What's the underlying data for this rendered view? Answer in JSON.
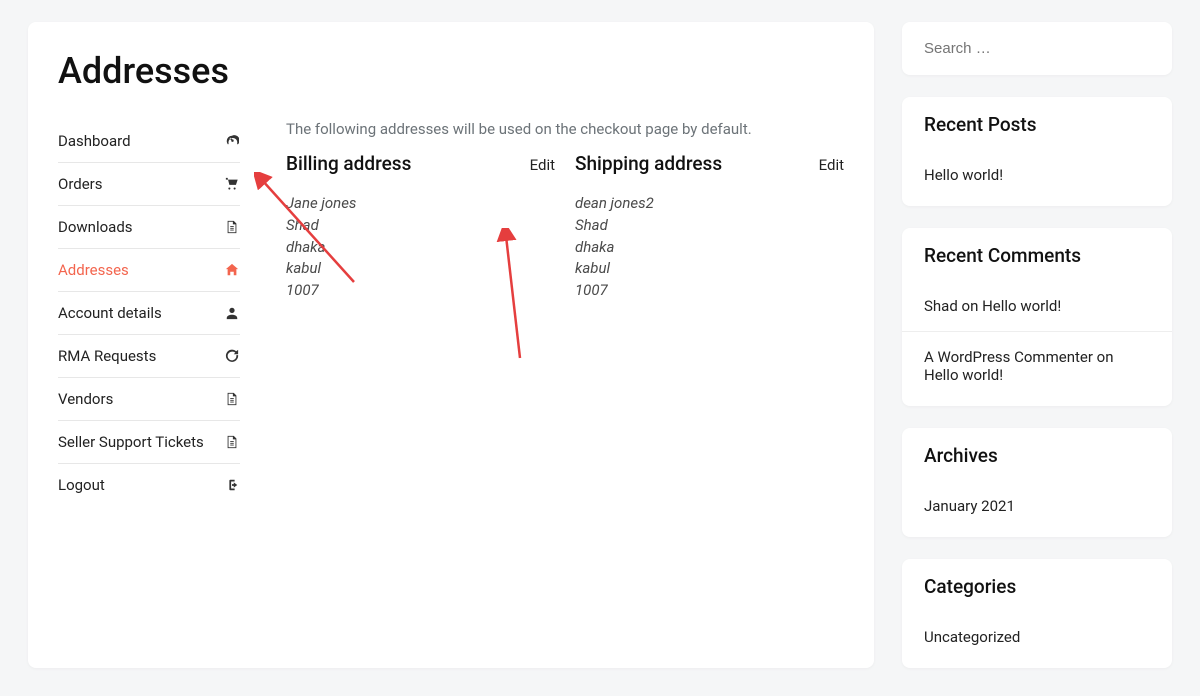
{
  "page": {
    "title": "Addresses",
    "intro": "The following addresses will be used on the checkout page by default."
  },
  "nav": [
    {
      "label": "Dashboard",
      "icon": "dashboard-icon",
      "active": false
    },
    {
      "label": "Orders",
      "icon": "cart-icon",
      "active": false
    },
    {
      "label": "Downloads",
      "icon": "file-icon",
      "active": false
    },
    {
      "label": "Addresses",
      "icon": "home-icon",
      "active": true
    },
    {
      "label": "Account details",
      "icon": "user-icon",
      "active": false
    },
    {
      "label": "RMA Requests",
      "icon": "refresh-icon",
      "active": false
    },
    {
      "label": "Vendors",
      "icon": "file-icon",
      "active": false
    },
    {
      "label": "Seller Support Tickets",
      "icon": "file-icon",
      "active": false
    },
    {
      "label": "Logout",
      "icon": "logout-icon",
      "active": false
    }
  ],
  "addresses": {
    "billing": {
      "title": "Billing address",
      "edit_label": "Edit",
      "lines": [
        "Jane jones",
        "Shad",
        "dhaka",
        "kabul",
        "1007"
      ]
    },
    "shipping": {
      "title": "Shipping address",
      "edit_label": "Edit",
      "lines": [
        "dean jones2",
        "Shad",
        "dhaka",
        "kabul",
        "1007"
      ]
    }
  },
  "sidebar": {
    "search_placeholder": "Search …",
    "recent_posts": {
      "title": "Recent Posts",
      "items": [
        "Hello world!"
      ]
    },
    "recent_comments": {
      "title": "Recent Comments",
      "items": [
        {
          "author": "Shad",
          "on": "on",
          "post": "Hello world!"
        },
        {
          "author": "A WordPress Commenter",
          "on": "on",
          "post": "Hello world!"
        }
      ]
    },
    "archives": {
      "title": "Archives",
      "items": [
        "January 2021"
      ]
    },
    "categories": {
      "title": "Categories",
      "items": [
        "Uncategorized"
      ]
    }
  }
}
